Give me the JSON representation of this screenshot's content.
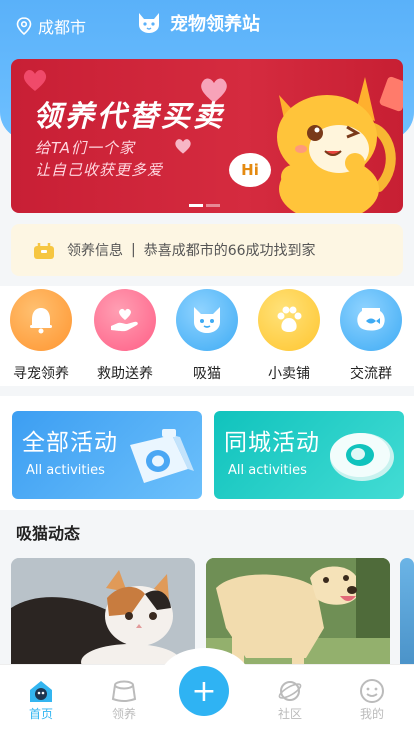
{
  "header": {
    "location": "成都市",
    "title": "宠物领养站"
  },
  "banner": {
    "title": "领养代替买卖",
    "sub_line1": "给TA们一个家",
    "sub_line2": "让自己收获更多爱",
    "hi": "Hi",
    "slide_count": 2,
    "active_slide": 1
  },
  "notice": {
    "label": "领养信息",
    "separator": "|",
    "message": "恭喜成都市的66成功找到家"
  },
  "categories": [
    {
      "label": "寻宠领养",
      "icon": "bell-icon",
      "color": "#ff9f3d"
    },
    {
      "label": "救助送养",
      "icon": "heart-hand-icon",
      "color": "#ff6b8f"
    },
    {
      "label": "吸猫",
      "icon": "cat-icon",
      "color": "#4db8f6"
    },
    {
      "label": "小卖铺",
      "icon": "paw-icon",
      "color": "#ffc93d"
    },
    {
      "label": "交流群",
      "icon": "fishbowl-icon",
      "color": "#4db8f6"
    }
  ],
  "activities": [
    {
      "title": "全部活动",
      "subtitle": "All activities",
      "color": "#4aa7f4"
    },
    {
      "title": "同城活动",
      "subtitle": "All activities",
      "color": "#1ccdc6"
    }
  ],
  "feed": {
    "title": "吸猫动态"
  },
  "tabbar": {
    "items": [
      {
        "label": "首页",
        "icon": "home-icon",
        "active": true
      },
      {
        "label": "领养",
        "icon": "bowl-icon",
        "active": false
      },
      {
        "label": "",
        "icon": "add-icon",
        "active": false
      },
      {
        "label": "社区",
        "icon": "planet-icon",
        "active": false
      },
      {
        "label": "我的",
        "icon": "smile-icon",
        "active": false
      }
    ],
    "add_symbol": "+"
  },
  "colors": {
    "primary": "#5ab1f9",
    "banner": "#c81f35",
    "notice_bg": "#fdf6e3",
    "tab_active": "#33b5f0"
  }
}
